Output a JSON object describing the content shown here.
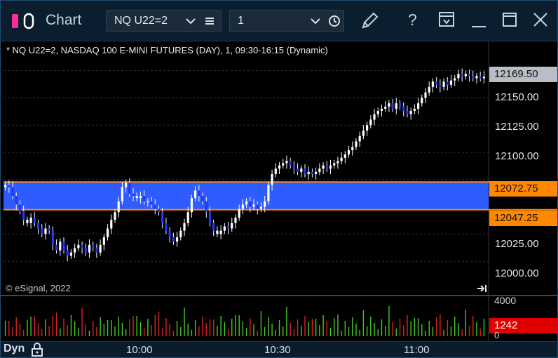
{
  "window": {
    "title": "Chart",
    "symbol": "NQ U22=2",
    "interval": "1",
    "icons": [
      "app-icon",
      "chevron-down-icon",
      "menu-icon",
      "clock-icon",
      "pencil-icon",
      "help-icon",
      "template-icon",
      "minimize-icon",
      "maximize-icon",
      "close-icon"
    ],
    "help_glyph": "?"
  },
  "chart": {
    "header": "* NQ U22=2, NASDAQ 100 E-MINI FUTURES (DAY), 1, 09:30-16:15 (Dynamic)",
    "copyright": "© eSignal, 2022",
    "price_labels": [
      "12150.00",
      "12125.00",
      "12100.00",
      "12025.00",
      "12000.00"
    ],
    "last_price": "12169.50",
    "zone_top": "12072.75",
    "zone_bottom": "12047.25",
    "volume_max_label": "4000",
    "volume_min_label": "0",
    "volume_last": "1242",
    "time_labels": [
      "10:00",
      "10:30",
      "11:00"
    ],
    "mode_label": "Dyn",
    "colors": {
      "background": "#000000",
      "up_candle": "#ffffff",
      "down_candle": "#2233ff",
      "zone_fill": "#2f5cff",
      "zone_border": "#ff8800",
      "volume_up": "#44cc22",
      "volume_down": "#dd2222"
    }
  },
  "chart_data": {
    "type": "candlestick",
    "y_range": [
      11982,
      12178
    ],
    "y_ticks": [
      12000,
      12025,
      12050,
      12075,
      12100,
      12125,
      12150,
      12175
    ],
    "x_ticks": [
      "10:00",
      "10:30",
      "11:00"
    ],
    "zone": [
      12047.25,
      12072.75
    ],
    "last": 12169.5,
    "series": [
      {
        "c": 12070,
        "d": 0
      },
      {
        "c": 12068,
        "d": 1
      },
      {
        "c": 12060,
        "d": 1
      },
      {
        "c": 12052,
        "d": 1
      },
      {
        "c": 12046,
        "d": 1
      },
      {
        "c": 12038,
        "d": 1
      },
      {
        "c": 12035,
        "d": 0
      },
      {
        "c": 12040,
        "d": 0
      },
      {
        "c": 12035,
        "d": 1
      },
      {
        "c": 12030,
        "d": 1
      },
      {
        "c": 12025,
        "d": 1
      },
      {
        "c": 12030,
        "d": 0
      },
      {
        "c": 12028,
        "d": 1
      },
      {
        "c": 12015,
        "d": 1
      },
      {
        "c": 12010,
        "d": 1
      },
      {
        "c": 12018,
        "d": 0
      },
      {
        "c": 12010,
        "d": 1
      },
      {
        "c": 12005,
        "d": 1
      },
      {
        "c": 12008,
        "d": 0
      },
      {
        "c": 12012,
        "d": 0
      },
      {
        "c": 12015,
        "d": 0
      },
      {
        "c": 12012,
        "d": 1
      },
      {
        "c": 12008,
        "d": 1
      },
      {
        "c": 12015,
        "d": 0
      },
      {
        "c": 12012,
        "d": 1
      },
      {
        "c": 12008,
        "d": 1
      },
      {
        "c": 12015,
        "d": 0
      },
      {
        "c": 12022,
        "d": 0
      },
      {
        "c": 12030,
        "d": 0
      },
      {
        "c": 12038,
        "d": 0
      },
      {
        "c": 12045,
        "d": 0
      },
      {
        "c": 12055,
        "d": 0
      },
      {
        "c": 12068,
        "d": 0
      },
      {
        "c": 12072,
        "d": 0
      },
      {
        "c": 12062,
        "d": 1
      },
      {
        "c": 12060,
        "d": 1
      },
      {
        "c": 12058,
        "d": 0
      },
      {
        "c": 12060,
        "d": 0
      },
      {
        "c": 12055,
        "d": 1
      },
      {
        "c": 12055,
        "d": 0
      },
      {
        "c": 12052,
        "d": 1
      },
      {
        "c": 12048,
        "d": 1
      },
      {
        "c": 12045,
        "d": 1
      },
      {
        "c": 12035,
        "d": 1
      },
      {
        "c": 12028,
        "d": 1
      },
      {
        "c": 12022,
        "d": 1
      },
      {
        "c": 12018,
        "d": 1
      },
      {
        "c": 12022,
        "d": 0
      },
      {
        "c": 12028,
        "d": 0
      },
      {
        "c": 12035,
        "d": 0
      },
      {
        "c": 12045,
        "d": 0
      },
      {
        "c": 12058,
        "d": 0
      },
      {
        "c": 12065,
        "d": 0
      },
      {
        "c": 12060,
        "d": 1
      },
      {
        "c": 12055,
        "d": 1
      },
      {
        "c": 12045,
        "d": 1
      },
      {
        "c": 12035,
        "d": 1
      },
      {
        "c": 12028,
        "d": 1
      },
      {
        "c": 12025,
        "d": 0
      },
      {
        "c": 12028,
        "d": 0
      },
      {
        "c": 12032,
        "d": 0
      },
      {
        "c": 12030,
        "d": 1
      },
      {
        "c": 12035,
        "d": 0
      },
      {
        "c": 12040,
        "d": 0
      },
      {
        "c": 12048,
        "d": 0
      },
      {
        "c": 12052,
        "d": 0
      },
      {
        "c": 12055,
        "d": 0
      },
      {
        "c": 12050,
        "d": 1
      },
      {
        "c": 12052,
        "d": 0
      },
      {
        "c": 12048,
        "d": 1
      },
      {
        "c": 12050,
        "d": 0
      },
      {
        "c": 12055,
        "d": 0
      },
      {
        "c": 12070,
        "d": 0
      },
      {
        "c": 12080,
        "d": 0
      },
      {
        "c": 12085,
        "d": 0
      },
      {
        "c": 12088,
        "d": 0
      },
      {
        "c": 12090,
        "d": 0
      },
      {
        "c": 12092,
        "d": 0
      },
      {
        "c": 12088,
        "d": 1
      },
      {
        "c": 12085,
        "d": 1
      },
      {
        "c": 12082,
        "d": 1
      },
      {
        "c": 12085,
        "d": 0
      },
      {
        "c": 12080,
        "d": 1
      },
      {
        "c": 12082,
        "d": 0
      },
      {
        "c": 12080,
        "d": 1
      },
      {
        "c": 12082,
        "d": 0
      },
      {
        "c": 12085,
        "d": 0
      },
      {
        "c": 12088,
        "d": 0
      },
      {
        "c": 12085,
        "d": 1
      },
      {
        "c": 12088,
        "d": 0
      },
      {
        "c": 12090,
        "d": 0
      },
      {
        "c": 12092,
        "d": 0
      },
      {
        "c": 12095,
        "d": 0
      },
      {
        "c": 12098,
        "d": 0
      },
      {
        "c": 12102,
        "d": 0
      },
      {
        "c": 12105,
        "d": 0
      },
      {
        "c": 12110,
        "d": 0
      },
      {
        "c": 12115,
        "d": 0
      },
      {
        "c": 12120,
        "d": 0
      },
      {
        "c": 12125,
        "d": 0
      },
      {
        "c": 12130,
        "d": 0
      },
      {
        "c": 12135,
        "d": 0
      },
      {
        "c": 12138,
        "d": 0
      },
      {
        "c": 12140,
        "d": 0
      },
      {
        "c": 12142,
        "d": 0
      },
      {
        "c": 12145,
        "d": 0
      },
      {
        "c": 12140,
        "d": 1
      },
      {
        "c": 12145,
        "d": 0
      },
      {
        "c": 12142,
        "d": 1
      },
      {
        "c": 12138,
        "d": 1
      },
      {
        "c": 12135,
        "d": 1
      },
      {
        "c": 12138,
        "d": 0
      },
      {
        "c": 12140,
        "d": 0
      },
      {
        "c": 12145,
        "d": 0
      },
      {
        "c": 12150,
        "d": 0
      },
      {
        "c": 12155,
        "d": 0
      },
      {
        "c": 12160,
        "d": 0
      },
      {
        "c": 12165,
        "d": 0
      },
      {
        "c": 12162,
        "d": 1
      },
      {
        "c": 12160,
        "d": 1
      },
      {
        "c": 12165,
        "d": 0
      },
      {
        "c": 12162,
        "d": 1
      },
      {
        "c": 12166,
        "d": 0
      },
      {
        "c": 12168,
        "d": 0
      },
      {
        "c": 12172,
        "d": 0
      },
      {
        "c": 12170,
        "d": 1
      },
      {
        "c": 12172,
        "d": 0
      },
      {
        "c": 12170,
        "d": 1
      },
      {
        "c": 12168,
        "d": 1
      },
      {
        "c": 12170,
        "d": 0
      },
      {
        "c": 12168,
        "d": 1
      },
      {
        "c": 12169.5,
        "d": 0
      }
    ]
  }
}
